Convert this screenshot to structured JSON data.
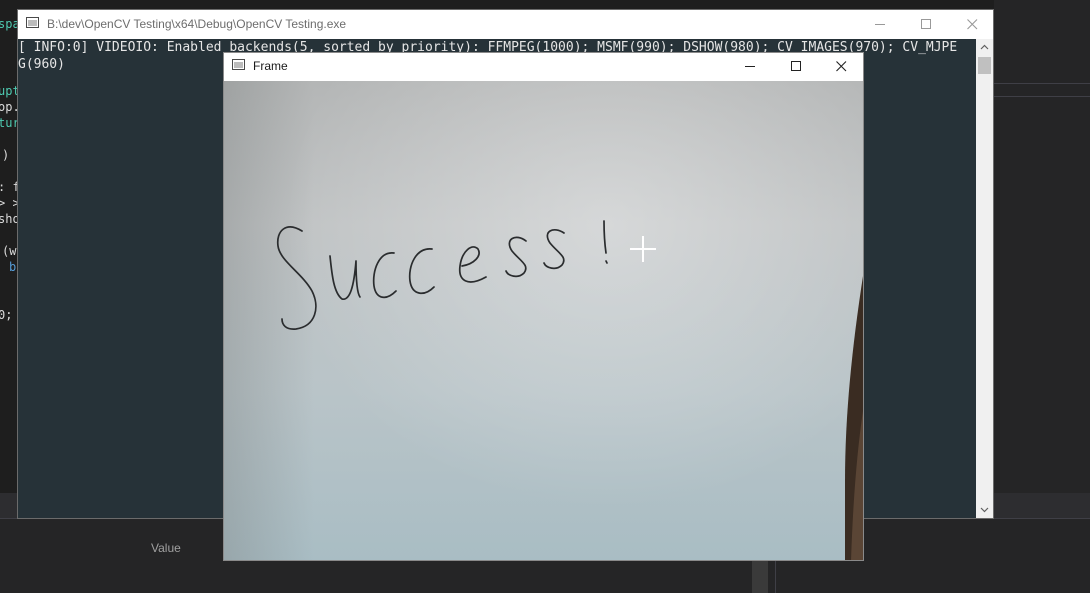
{
  "ide": {
    "code_fragments": [
      "spa",
      "upt",
      "op.",
      "tur",
      ")",
      ": f",
      "> >",
      "sho",
      "(w",
      "b",
      "0;"
    ],
    "bottom_panel": {
      "value_header": "Value"
    }
  },
  "console_window": {
    "title": "B:\\dev\\OpenCV Testing\\x64\\Debug\\OpenCV Testing.exe",
    "output_lines": [
      "[ INFO:0] VIDEOIO: Enabled backends(5, sorted by priority): FFMPEG(1000); MSMF(990); DSHOW(980); CV_IMAGES(970); CV_MJPE",
      "G(960)"
    ],
    "background_color": "#263238"
  },
  "frame_window": {
    "title": "Frame",
    "camera_view": {
      "handwritten_text": "Success!",
      "cursor": "crosshair-cursor-icon"
    }
  },
  "icons": {
    "minimize": "minimize-icon",
    "maximize": "maximize-icon",
    "close": "close-icon",
    "app": "window-app-icon"
  }
}
